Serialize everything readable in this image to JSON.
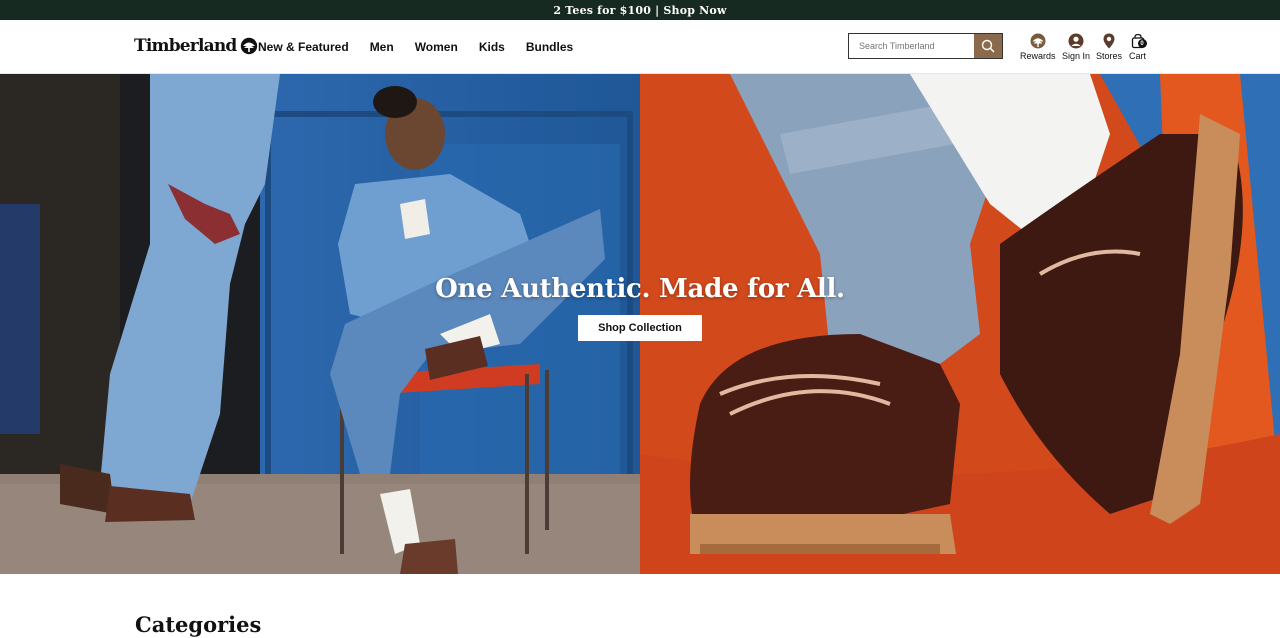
{
  "promo": {
    "text": "2 Tees for $100 | Shop Now"
  },
  "header": {
    "logo_text": "Timberland",
    "nav": [
      "New & Featured",
      "Men",
      "Women",
      "Kids",
      "Bundles"
    ],
    "search_placeholder": "Search Timberland",
    "utilities": [
      {
        "label": "Rewards",
        "icon": "tree-icon"
      },
      {
        "label": "Sign In",
        "icon": "user-icon"
      },
      {
        "label": "Stores",
        "icon": "map-pin-icon"
      },
      {
        "label": "Cart",
        "icon": "bag-icon",
        "count": "0"
      }
    ]
  },
  "hero": {
    "headline": "One Authentic. Made for All.",
    "cta": "Shop Collection"
  },
  "sections": {
    "categories_title": "Categories"
  },
  "colors": {
    "promo_bg": "#172a21",
    "search_button": "#8a6a4b",
    "hero_left_blue": "#2f6fb5",
    "hero_right_orange": "#d2491c"
  }
}
